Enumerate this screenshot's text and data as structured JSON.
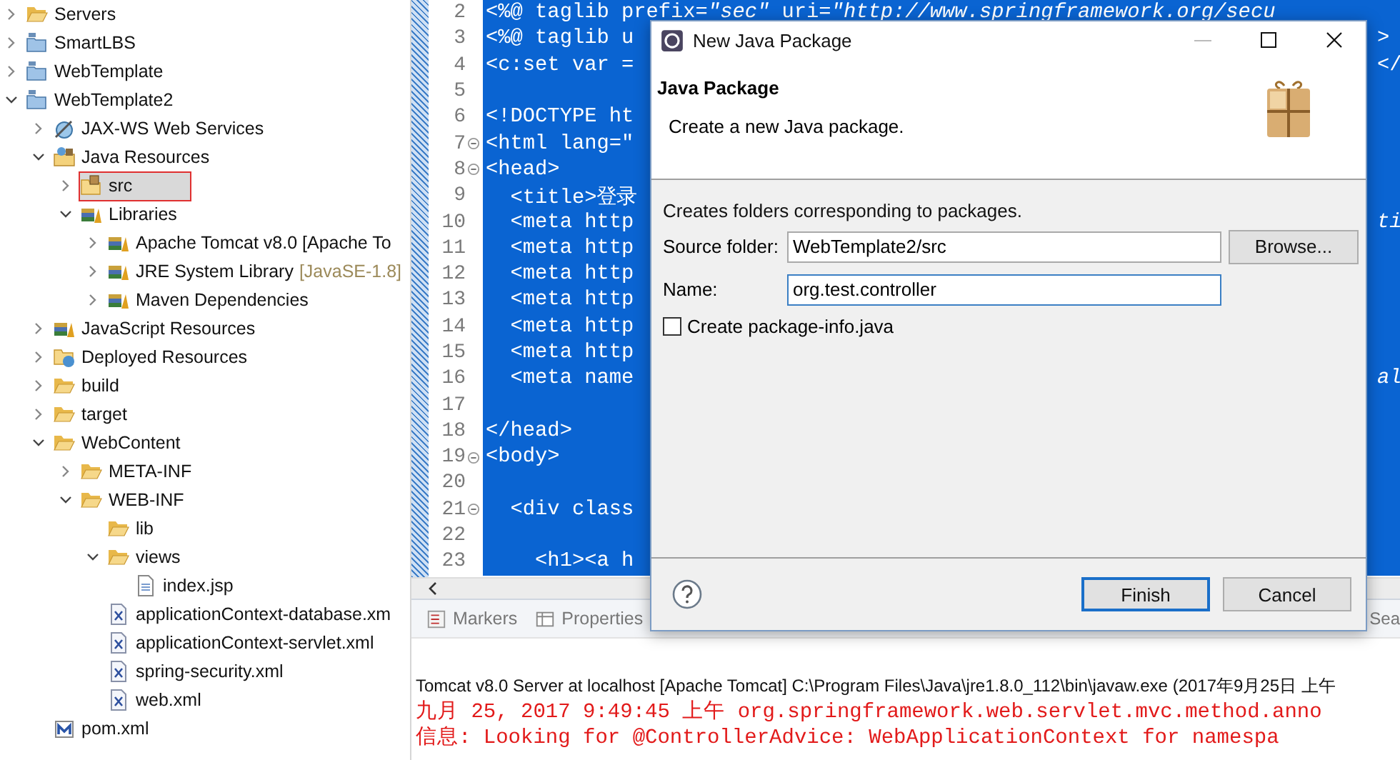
{
  "explorer": {
    "items": [
      {
        "label": "Servers",
        "kind": "folder",
        "expanded": false,
        "selected": false
      },
      {
        "label": "SmartLBS",
        "kind": "project",
        "expanded": false,
        "selected": false
      },
      {
        "label": "WebTemplate",
        "kind": "project",
        "expanded": false,
        "selected": false
      },
      {
        "label": "WebTemplate2",
        "kind": "project",
        "expanded": true,
        "selected": false,
        "children": [
          {
            "label": "JAX-WS Web Services",
            "kind": "webservice",
            "expanded": false,
            "selected": false
          },
          {
            "label": "Java Resources",
            "kind": "java-resources",
            "expanded": true,
            "selected": false,
            "children": [
              {
                "label": "src",
                "kind": "source-folder",
                "expanded": false,
                "selected": true
              },
              {
                "label": "Libraries",
                "kind": "library",
                "expanded": true,
                "selected": false,
                "children": [
                  {
                    "label": "Apache Tomcat v8.0 [Apache To",
                    "kind": "library",
                    "expanded": false,
                    "selected": false
                  },
                  {
                    "label": "JRE System Library",
                    "decoration": "[JavaSE-1.8]",
                    "kind": "library",
                    "expanded": false,
                    "selected": false
                  },
                  {
                    "label": "Maven Dependencies",
                    "kind": "library",
                    "expanded": false,
                    "selected": false
                  }
                ]
              }
            ]
          },
          {
            "label": "JavaScript Resources",
            "kind": "library",
            "expanded": false,
            "selected": false
          },
          {
            "label": "Deployed Resources",
            "kind": "deployed",
            "expanded": false,
            "selected": false
          },
          {
            "label": "build",
            "kind": "folder",
            "expanded": false,
            "selected": false
          },
          {
            "label": "target",
            "kind": "folder",
            "expanded": false,
            "selected": false
          },
          {
            "label": "WebContent",
            "kind": "folder",
            "expanded": true,
            "selected": false,
            "children": [
              {
                "label": "META-INF",
                "kind": "folder",
                "expanded": false,
                "selected": false
              },
              {
                "label": "WEB-INF",
                "kind": "folder",
                "expanded": true,
                "selected": false,
                "children": [
                  {
                    "label": "lib",
                    "kind": "folder",
                    "selected": false
                  },
                  {
                    "label": "views",
                    "kind": "folder",
                    "expanded": true,
                    "selected": false,
                    "children": [
                      {
                        "label": "index.jsp",
                        "kind": "jsp-file",
                        "selected": false
                      }
                    ]
                  },
                  {
                    "label": "applicationContext-database.xm",
                    "kind": "xml-file",
                    "selected": false
                  },
                  {
                    "label": "applicationContext-servlet.xml",
                    "kind": "xml-file",
                    "selected": false
                  },
                  {
                    "label": "spring-security.xml",
                    "kind": "xml-file",
                    "selected": false
                  },
                  {
                    "label": "web.xml",
                    "kind": "xml-file",
                    "selected": false
                  }
                ]
              }
            ]
          },
          {
            "label": "pom.xml",
            "kind": "maven-file",
            "selected": false
          }
        ]
      }
    ]
  },
  "editor": {
    "lines": [
      {
        "number": "2",
        "code": "<%@ taglib prefix=*\"sec\"* uri=*\"http://www.springframework.org/secu*",
        "foldable": false
      },
      {
        "number": "3",
        "code": "<%@ taglib u",
        "right": ">",
        "foldable": false
      },
      {
        "number": "4",
        "code": "<c:set var =",
        "right": "</",
        "foldable": false
      },
      {
        "number": "5",
        "foldable": false
      },
      {
        "number": "6",
        "code": "<!DOCTYPE ht",
        "foldable": false
      },
      {
        "number": "7",
        "code": "<html lang=\"",
        "foldable": true
      },
      {
        "number": "8",
        "code": "<head>",
        "foldable": true
      },
      {
        "number": "9",
        "code": "  <title>登录",
        "foldable": false
      },
      {
        "number": "10",
        "code": "  <meta http",
        "right": "*ti*",
        "foldable": false
      },
      {
        "number": "11",
        "code": "  <meta http",
        "foldable": false
      },
      {
        "number": "12",
        "code": "  <meta http",
        "foldable": false
      },
      {
        "number": "13",
        "code": "  <meta http",
        "foldable": false
      },
      {
        "number": "14",
        "code": "  <meta http",
        "foldable": false
      },
      {
        "number": "15",
        "code": "  <meta http",
        "foldable": false
      },
      {
        "number": "16",
        "code": "  <meta name",
        "right": "*al*",
        "foldable": false
      },
      {
        "number": "17",
        "foldable": false
      },
      {
        "number": "18",
        "code": "</head>",
        "foldable": false
      },
      {
        "number": "19",
        "code": "<body>",
        "foldable": true
      },
      {
        "number": "20",
        "foldable": false
      },
      {
        "number": "21",
        "code": "  <div class",
        "foldable": true
      },
      {
        "number": "22",
        "foldable": false
      },
      {
        "number": "23",
        "code": "    <h1><a h",
        "foldable": false
      }
    ]
  },
  "bottom_panel": {
    "tabs": [
      {
        "label": "Markers",
        "kind": "markers"
      },
      {
        "label": "Properties",
        "kind": "properties"
      },
      {
        "label": "Sea",
        "kind": "cut"
      }
    ],
    "console": {
      "header": "Tomcat v8.0 Server at localhost [Apache Tomcat] C:\\Program Files\\Java\\jre1.8.0_112\\bin\\javaw.exe (2017年9月25日 上午",
      "lines": [
        "九月 25, 2017 9:49:45 上午 org.springframework.web.servlet.mvc.method.anno",
        "信息: Looking for @ControllerAdvice: WebApplicationContext for namespa"
      ]
    }
  },
  "dialog": {
    "title": "New Java Package",
    "heading": "Java Package",
    "description": "Create a new Java package.",
    "intro": "Creates folders corresponding to packages.",
    "fields": [
      {
        "label": "Source folder:",
        "value": "WebTemplate2/src",
        "focused": false,
        "button": "Browse..."
      },
      {
        "label": "Name:",
        "value": "org.test.controller",
        "focused": true
      }
    ],
    "checkbox": {
      "label": "Create package-info.java",
      "checked": false
    },
    "buttons": [
      {
        "label": "Finish",
        "default": true
      },
      {
        "label": "Cancel",
        "default": false
      }
    ]
  }
}
